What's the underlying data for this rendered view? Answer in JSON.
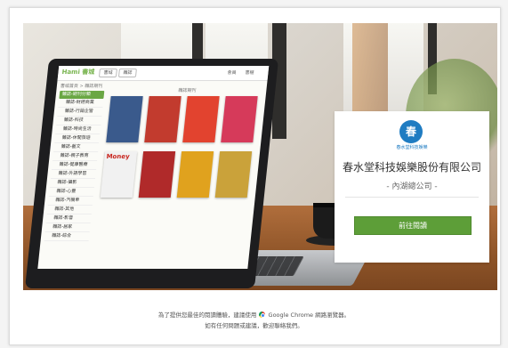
{
  "card": {
    "logo_glyph": "春",
    "logo_text": "春水堂科技娛樂",
    "company_name": "春水堂科技娛樂股份有限公司",
    "branch": "- 內湖總公司 -",
    "login_label": "前往閱讀"
  },
  "laptop": {
    "app_logo": "Hami 書城",
    "nav_buttons": [
      "書城",
      "雜誌"
    ],
    "top_right": [
      "會員",
      "書櫃"
    ],
    "breadcrumb": "書城首頁 > 雜誌期刊",
    "grid_title": "雜誌期刊",
    "sidebar_head": "雜誌-期刊分類",
    "sidebar_items": [
      "雜誌-財經商業",
      "雜誌-行銷企管",
      "雜誌-科技",
      "雜誌-時尚生活",
      "雜誌-休閒旅遊",
      "雜誌-藝文",
      "雜誌-親子教育",
      "雜誌-健康醫療",
      "雜誌-外語學習",
      "雜誌-攝影",
      "雜誌-心靈",
      "雜誌-汽機車",
      "雜誌-其他",
      "雜誌-影音",
      "雜誌-居家",
      "雜誌-綜合"
    ],
    "magazines_row1": [
      {
        "cap": "",
        "color": "#3a5a8c"
      },
      {
        "cap": "",
        "color": "#c23b2e"
      },
      {
        "cap": "",
        "color": "#e2432f"
      },
      {
        "cap": "",
        "color": "#d63a5a"
      }
    ],
    "magazines_row2": [
      {
        "cap": "Money",
        "color": "#f1f1f1"
      },
      {
        "cap": "",
        "color": "#b02a2a"
      },
      {
        "cap": "",
        "color": "#e0a21e"
      },
      {
        "cap": "",
        "color": "#caa23a"
      }
    ]
  },
  "footer": {
    "line1_before": "為了提供您最佳的閱讀體驗，建議使用",
    "line1_browser": "Google Chrome",
    "line1_after": "網路瀏覽器。",
    "line2": "如有任何問題或建議，歡迎聯絡我們。"
  }
}
